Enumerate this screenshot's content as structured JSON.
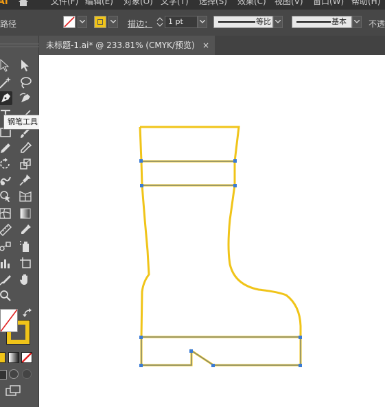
{
  "menubar": {
    "app_logo": "Ai",
    "items": [
      "文件(F)",
      "编辑(E)",
      "对象(O)",
      "文字(T)",
      "选择(S)",
      "效果(C)",
      "视图(V)",
      "窗口(W)",
      "帮助(H)"
    ]
  },
  "control_bar": {
    "object_type": "路径",
    "stroke_label": "描边：",
    "stroke_weight": "1 pt",
    "profile_label": "等比",
    "brush_label": "基本",
    "opacity_label": "不透"
  },
  "document_tab": {
    "title": "未标题-1.ai* @ 233.81% (CMYK/预览)",
    "close": "×"
  },
  "tooltip": {
    "text": "钢笔工具 (P)"
  },
  "colors": {
    "path_stroke": "#f0c419",
    "anchor": "#3a7bd5",
    "selection_line": "#4a6fb0",
    "fill_swatch": "#f0c419"
  },
  "icons": [
    "home-icon",
    "selection-tool-icon",
    "direct-selection-tool-icon",
    "magic-wand-icon",
    "lasso-icon",
    "pen-tool-icon",
    "curvature-tool-icon",
    "type-tool-icon",
    "line-tool-icon",
    "rectangle-tool-icon",
    "paintbrush-icon",
    "pencil-icon",
    "eraser-icon",
    "rotate-tool-icon",
    "scale-tool-icon",
    "warp-tool-icon",
    "puppet-warp-icon",
    "shape-builder-icon",
    "perspective-grid-icon",
    "mesh-tool-icon",
    "gradient-tool-icon",
    "eyedropper-icon",
    "measure-icon",
    "blend-tool-icon",
    "symbol-sprayer-icon",
    "column-graph-icon",
    "artboard-tool-icon",
    "slice-tool-icon",
    "hand-tool-icon",
    "zoom-tool-icon",
    "swap-colors-icon",
    "screen-mode-icon"
  ]
}
